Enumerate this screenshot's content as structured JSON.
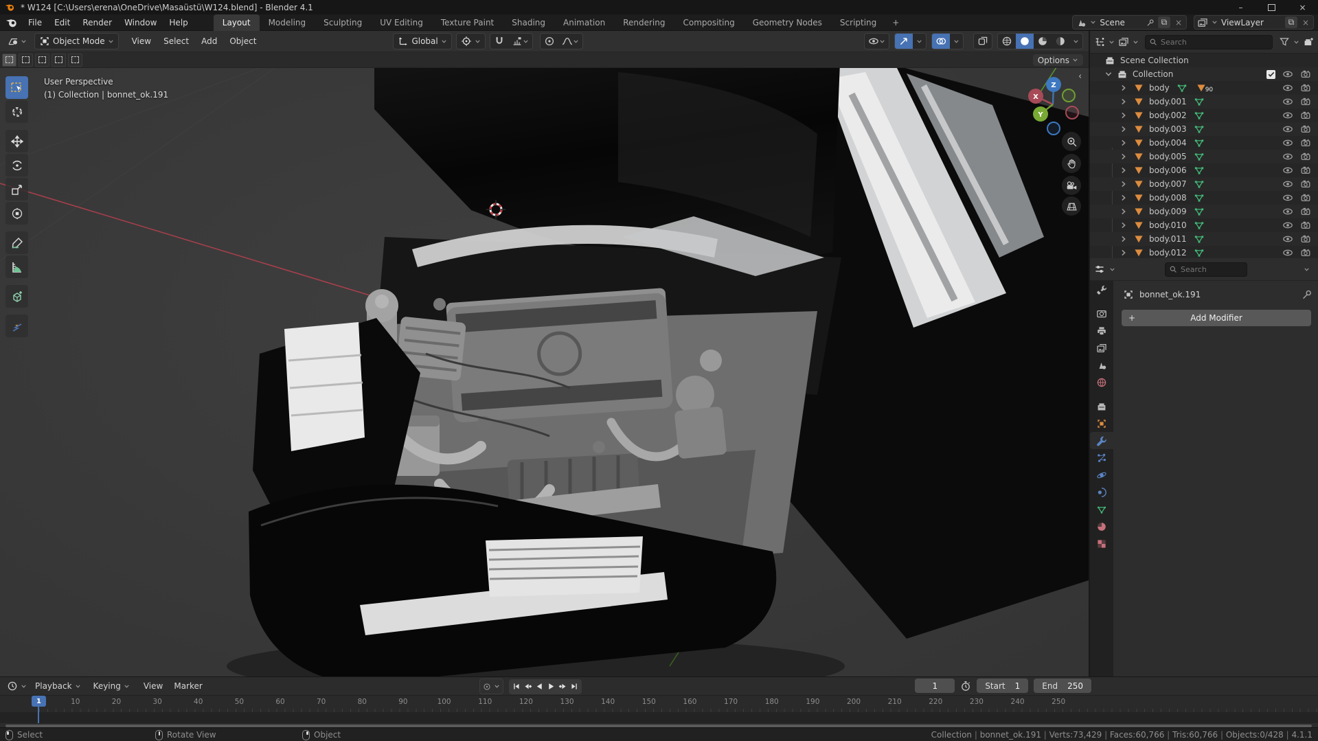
{
  "window": {
    "title": "* W124 [C:\\Users\\erena\\OneDrive\\Masaüstü\\W124.blend] - Blender 4.1"
  },
  "topbar": {
    "menus": [
      "File",
      "Edit",
      "Render",
      "Window",
      "Help"
    ],
    "workspaces": [
      {
        "label": "Layout",
        "active": true
      },
      {
        "label": "Modeling"
      },
      {
        "label": "Sculpting"
      },
      {
        "label": "UV Editing"
      },
      {
        "label": "Texture Paint"
      },
      {
        "label": "Shading"
      },
      {
        "label": "Animation"
      },
      {
        "label": "Rendering"
      },
      {
        "label": "Compositing"
      },
      {
        "label": "Geometry Nodes"
      },
      {
        "label": "Scripting"
      }
    ],
    "add_workspace": "+",
    "scene_selector": {
      "value": "Scene"
    },
    "viewlayer_selector": {
      "value": "ViewLayer"
    }
  },
  "viewport": {
    "header": {
      "mode": "Object Mode",
      "menus": [
        "View",
        "Select",
        "Add",
        "Object"
      ],
      "orientation": "Global"
    },
    "toolsettings": {
      "options": "Options"
    },
    "overlay": {
      "perspective": "User Perspective",
      "context": "(1) Collection | bonnet_ok.191"
    },
    "gizmo": {
      "x": "X",
      "y": "Y",
      "z": "Z"
    }
  },
  "outliner": {
    "search_placeholder": "Search",
    "scene_collection": "Scene Collection",
    "collection": "Collection",
    "first_item": {
      "label": "body",
      "badge": "90"
    },
    "items": [
      {
        "label": "body.001"
      },
      {
        "label": "body.002"
      },
      {
        "label": "body.003"
      },
      {
        "label": "body.004"
      },
      {
        "label": "body.005"
      },
      {
        "label": "body.006"
      },
      {
        "label": "body.007"
      },
      {
        "label": "body.008"
      },
      {
        "label": "body.009"
      },
      {
        "label": "body.010"
      },
      {
        "label": "body.011"
      },
      {
        "label": "body.012"
      }
    ]
  },
  "properties": {
    "search_placeholder": "Search",
    "object_name": "bonnet_ok.191",
    "plus": "+",
    "add_modifier": "Add Modifier",
    "tabs": [
      {
        "icon": "toolico",
        "name": "tool"
      },
      {
        "icon": "renderico",
        "name": "render"
      },
      {
        "icon": "printerico",
        "name": "output"
      },
      {
        "icon": "imgsico",
        "name": "view-layer"
      },
      {
        "icon": "sceneico",
        "name": "scene"
      },
      {
        "icon": "worldico",
        "name": "world",
        "color": "#c5707a"
      },
      {
        "icon": "boxcol",
        "name": "collection"
      },
      {
        "icon": "objico",
        "name": "object",
        "color": "#dd8c3e"
      },
      {
        "icon": "wrenchico",
        "name": "modifiers",
        "color": "#5a84c4",
        "active": true
      },
      {
        "icon": "partico",
        "name": "particles",
        "color": "#5a84c4"
      },
      {
        "icon": "physico",
        "name": "physics",
        "color": "#5a84c4"
      },
      {
        "icon": "constrico",
        "name": "constraints",
        "color": "#5a84c4"
      },
      {
        "icon": "dataico",
        "name": "object-data",
        "color": "#43b878"
      },
      {
        "icon": "matico",
        "name": "material",
        "color": "#c5707a"
      },
      {
        "icon": "texico",
        "name": "texture",
        "color": "#c5707a"
      }
    ]
  },
  "timeline": {
    "dropdown_menus": [
      "Playback",
      "Keying"
    ],
    "plain_menus": [
      "View",
      "Marker"
    ],
    "current_frame": "1",
    "start_label": "Start",
    "start_value": "1",
    "end_label": "End",
    "end_value": "250",
    "playhead": "1",
    "ruler": [
      "10",
      "20",
      "30",
      "40",
      "50",
      "60",
      "70",
      "80",
      "90",
      "100",
      "110",
      "120",
      "130",
      "140",
      "150",
      "160",
      "170",
      "180",
      "190",
      "200",
      "210",
      "220",
      "230",
      "240",
      "250"
    ]
  },
  "statusbar": {
    "hints": [
      {
        "label": "Select",
        "button": "left"
      },
      {
        "label": "Rotate View",
        "button": "middle"
      },
      {
        "label": "Object",
        "button": "right"
      }
    ],
    "stats": [
      "Collection",
      "bonnet_ok.191",
      "Verts:73,429",
      "Faces:60,766",
      "Tris:60,766",
      "Objects:0/428",
      "4.1.1"
    ]
  },
  "colors": {
    "accent": "#4772b3",
    "mesh_orange": "#dd8c3e",
    "data_green": "#43b878",
    "axis_x": "#b8404f",
    "axis_y": "#5d9e2f",
    "axis_z": "#3d72aa"
  }
}
